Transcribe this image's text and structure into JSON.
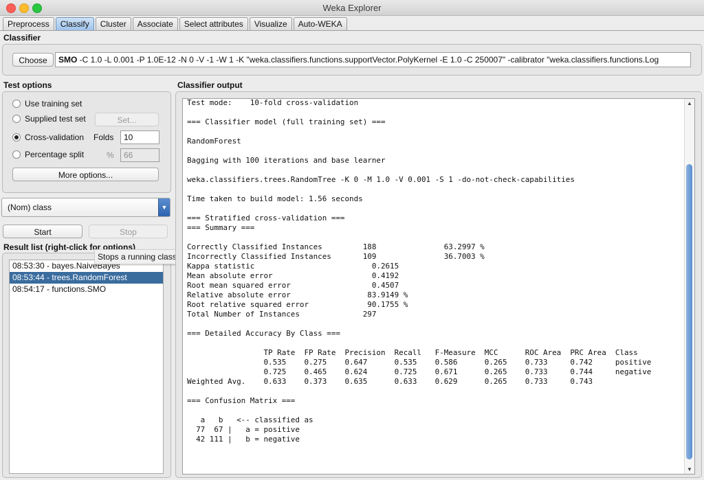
{
  "window": {
    "title": "Weka Explorer"
  },
  "tabs": [
    {
      "label": "Preprocess",
      "active": false
    },
    {
      "label": "Classify",
      "active": true
    },
    {
      "label": "Cluster",
      "active": false
    },
    {
      "label": "Associate",
      "active": false
    },
    {
      "label": "Select attributes",
      "active": false
    },
    {
      "label": "Visualize",
      "active": false
    },
    {
      "label": "Auto-WEKA",
      "active": false
    }
  ],
  "classifier": {
    "section_title": "Classifier",
    "choose_label": "Choose",
    "name": "SMO",
    "options": " -C 1.0 -L 0.001 -P 1.0E-12 -N 0 -V -1 -W 1 -K \"weka.classifiers.functions.supportVector.PolyKernel -E 1.0 -C 250007\" -calibrator \"weka.classifiers.functions.Log"
  },
  "test_options": {
    "section_title": "Test options",
    "use_training_set": "Use training set",
    "supplied_test_set": "Supplied test set",
    "set_button": "Set...",
    "cross_validation": "Cross-validation",
    "folds_label": "Folds",
    "folds_value": "10",
    "percentage_split": "Percentage split",
    "percent_symbol": "%",
    "percent_value": "66",
    "more_options": "More options...",
    "selected": "cross_validation"
  },
  "class_selector": {
    "value": "(Nom) class"
  },
  "actions": {
    "start": "Start",
    "stop": "Stop"
  },
  "result_list": {
    "section_title": "Result list (right-click for options)",
    "items": [
      {
        "label": "08:53:30 - bayes.NaiveBayes",
        "selected": false
      },
      {
        "label": "08:53:44 - trees.RandomForest",
        "selected": true
      },
      {
        "label": "08:54:17 - functions.SMO",
        "selected": false
      }
    ]
  },
  "tooltip": {
    "text": "Stops a running classification"
  },
  "output": {
    "section_title": "Classifier output",
    "lines": [
      "Test mode:    10-fold cross-validation",
      "",
      "=== Classifier model (full training set) ===",
      "",
      "RandomForest",
      "",
      "Bagging with 100 iterations and base learner",
      "",
      "weka.classifiers.trees.RandomTree -K 0 -M 1.0 -V 0.001 -S 1 -do-not-check-capabilities",
      "",
      "Time taken to build model: 1.56 seconds",
      "",
      "=== Stratified cross-validation ===",
      "=== Summary ===",
      "",
      "Correctly Classified Instances         188               63.2997 %",
      "Incorrectly Classified Instances       109               36.7003 %",
      "Kappa statistic                          0.2615",
      "Mean absolute error                      0.4192",
      "Root mean squared error                  0.4507",
      "Relative absolute error                 83.9149 %",
      "Root relative squared error             90.1755 %",
      "Total Number of Instances              297",
      "",
      "=== Detailed Accuracy By Class ===",
      "",
      "                 TP Rate  FP Rate  Precision  Recall   F-Measure  MCC      ROC Area  PRC Area  Class",
      "                 0.535    0.275    0.647      0.535    0.586      0.265    0.733     0.742     positive",
      "                 0.725    0.465    0.624      0.725    0.671      0.265    0.733     0.744     negative",
      "Weighted Avg.    0.633    0.373    0.635      0.633    0.629      0.265    0.733     0.743",
      "",
      "=== Confusion Matrix ===",
      "",
      "   a   b   <-- classified as",
      "  77  67 |   a = positive",
      "  42 111 |   b = negative"
    ]
  }
}
